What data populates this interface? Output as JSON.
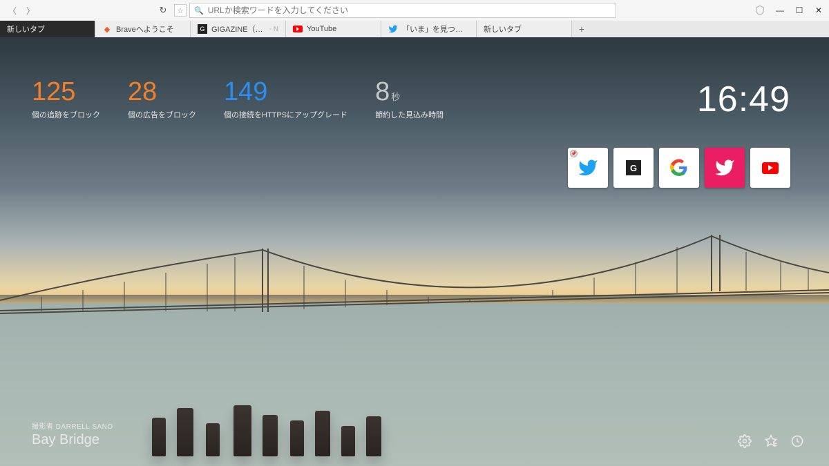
{
  "chrome": {
    "placeholder": "URLか検索ワードを入力してください"
  },
  "tabs": [
    {
      "label": "新しいタブ",
      "active": true,
      "icon": "none"
    },
    {
      "label": "Braveへようこそ",
      "icon": "brave"
    },
    {
      "label": "GIGAZINE（ギガジン）",
      "extra": "- N",
      "icon": "gigazine"
    },
    {
      "label": "YouTube",
      "icon": "youtube"
    },
    {
      "label": "「いま」を見つけよう",
      "icon": "twitter"
    },
    {
      "label": "新しいタブ",
      "icon": "none"
    }
  ],
  "stats": {
    "trackers": {
      "value": "125",
      "label": "個の追跡をブロック"
    },
    "ads": {
      "value": "28",
      "label": "個の広告をブロック"
    },
    "https": {
      "value": "149",
      "label": "個の接続をHTTPSにアップグレード"
    },
    "time": {
      "value": "8",
      "unit": "秒",
      "label": "節約した見込み時間"
    }
  },
  "clock": "16:49",
  "tiles": [
    {
      "name": "twitter",
      "pinned": true,
      "bg": "white"
    },
    {
      "name": "gigazine",
      "bg": "white"
    },
    {
      "name": "google",
      "bg": "white"
    },
    {
      "name": "twitter",
      "bg": "pink"
    },
    {
      "name": "youtube",
      "bg": "white"
    }
  ],
  "credit": {
    "by_prefix": "撮影者",
    "author": "DARRELL SANO",
    "title": "Bay Bridge"
  }
}
